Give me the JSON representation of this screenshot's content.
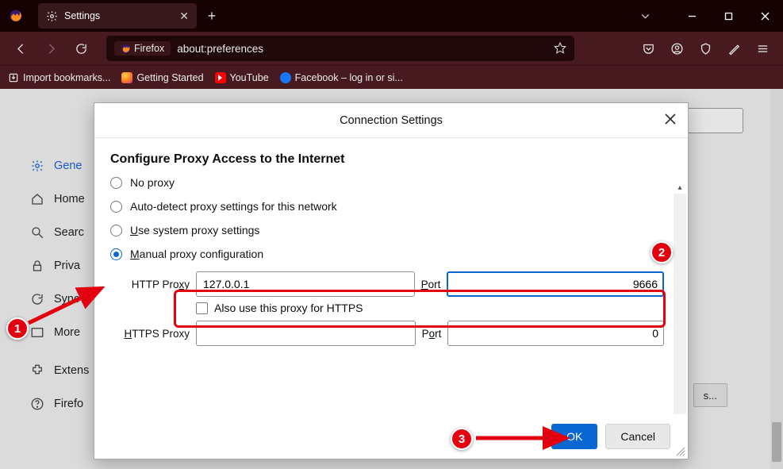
{
  "window": {
    "tab_title": "Settings",
    "newtab_glyph": "+",
    "chevron": "⌄"
  },
  "navbar": {
    "url_badge": "Firefox",
    "url_text": "about:preferences"
  },
  "bookmarks": {
    "import": "Import bookmarks...",
    "getting_started": "Getting Started",
    "youtube": "YouTube",
    "facebook": "Facebook – log in or si..."
  },
  "prefs_sidebar": {
    "general": "Gene",
    "home": "Home",
    "search": "Searc",
    "privacy": "Priva",
    "sync": "Sync",
    "more": "More",
    "extensions": "Extens",
    "support": "Firefo"
  },
  "options_button": "s...",
  "dialog": {
    "title": "Connection Settings",
    "heading": "Configure Proxy Access to the Internet",
    "radio_no_proxy": "No proxy",
    "radio_autodetect": "Auto-detect proxy settings for this network",
    "radio_system_pre": "",
    "radio_system_u": "U",
    "radio_system_rest": "se system proxy settings",
    "radio_manual_m": "M",
    "radio_manual_rest": "anual proxy configuration",
    "http_label": "HTTP Pro",
    "http_x": "x",
    "http_y": "y",
    "http_value": "127.0.0.1",
    "port_p": "P",
    "port_rest": "ort",
    "http_port_value": "9666",
    "also_https": "Also use this proxy for HTTPS",
    "https_h": "H",
    "https_rest": "TTPS Proxy",
    "https_value": "",
    "https_port_p": "P",
    "https_port_rest": "ort",
    "https_port_value": "0",
    "ok": "OK",
    "cancel": "Cancel"
  },
  "annotations": {
    "n1": "1",
    "n2": "2",
    "n3": "3"
  }
}
